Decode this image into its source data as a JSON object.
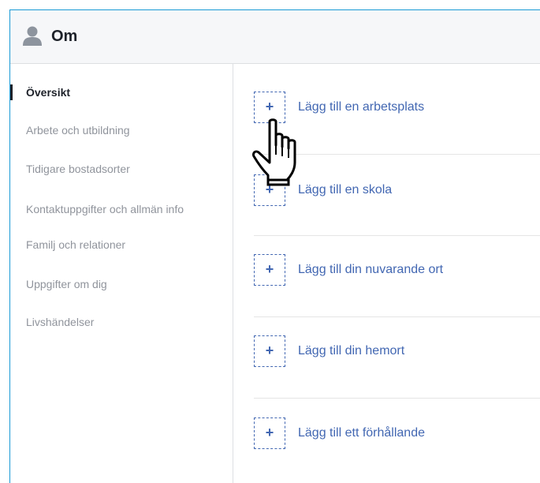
{
  "header": {
    "title": "Om",
    "icon": "person-icon"
  },
  "sidebar": {
    "items": [
      {
        "label": "Översikt",
        "active": true
      },
      {
        "label": "Arbete och utbildning",
        "active": false
      },
      {
        "label": "Tidigare bostadsorter",
        "active": false
      },
      {
        "label": "Kontaktuppgifter och allmän info",
        "active": false
      },
      {
        "label": "Familj och relationer",
        "active": false
      },
      {
        "label": "Uppgifter om dig",
        "active": false
      },
      {
        "label": "Livshändelser",
        "active": false
      }
    ]
  },
  "main": {
    "add_items": [
      {
        "symbol": "+",
        "label": "Lägg till en arbetsplats"
      },
      {
        "symbol": "+",
        "label": "Lägg till en skola"
      },
      {
        "symbol": "+",
        "label": "Lägg till din nuvarande ort"
      },
      {
        "symbol": "+",
        "label": "Lägg till din hemort"
      },
      {
        "symbol": "+",
        "label": "Lägg till ett förhållande"
      }
    ]
  },
  "colors": {
    "accent_border": "#1a9ad6",
    "link": "#4267b2",
    "muted_text": "#90949c",
    "dark_text": "#1d2129"
  },
  "cursor": "hand-pointer-icon"
}
